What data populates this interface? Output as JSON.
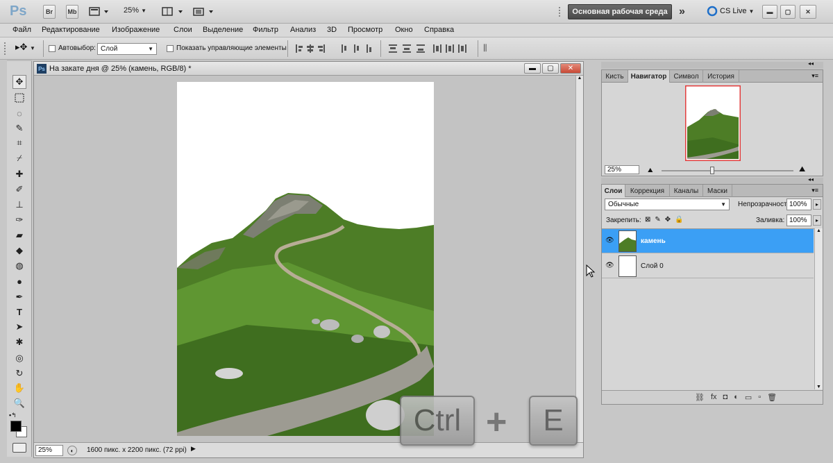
{
  "app": {
    "logo": "Ps",
    "bridge_label": "Br",
    "minibridge_label": "Mb",
    "zoom": "25%",
    "workspace": "Основная рабочая среда",
    "cs_live": "CS Live"
  },
  "menu": [
    "Файл",
    "Редактирование",
    "Изображение",
    "Слои",
    "Выделение",
    "Фильтр",
    "Анализ",
    "3D",
    "Просмотр",
    "Окно",
    "Справка"
  ],
  "options": {
    "autoselect_label": "Автовыбор:",
    "autoselect_value": "Слой",
    "show_controls_label": "Показать управляющие элементы"
  },
  "document": {
    "title": "На закате дня @ 25% (камень, RGB/8) *",
    "zoom": "25%",
    "info": "1600 пикс. x 2200 пикс. (72 ppi)"
  },
  "navigator": {
    "tabs": [
      "Кисть",
      "Навигатор",
      "Символ",
      "История"
    ],
    "active_tab": "Навигатор",
    "zoom": "25%"
  },
  "layers_panel": {
    "tabs": [
      "Слои",
      "Коррекция",
      "Каналы",
      "Маски"
    ],
    "active_tab": "Слои",
    "blend_mode": "Обычные",
    "opacity_label": "Непрозрачность:",
    "opacity_value": "100%",
    "lock_label": "Закрепить:",
    "fill_label": "Заливка:",
    "fill_value": "100%",
    "layers": [
      {
        "name": "камень",
        "selected": true
      },
      {
        "name": "Слой 0",
        "selected": false
      }
    ]
  },
  "shortcut_overlay": {
    "key1": "Ctrl",
    "plus": "+",
    "key2": "E"
  },
  "colors": {
    "selection_blue": "#3b9ff5",
    "navigator_frame": "#e23c3c",
    "grass": "#5a8a2b"
  }
}
